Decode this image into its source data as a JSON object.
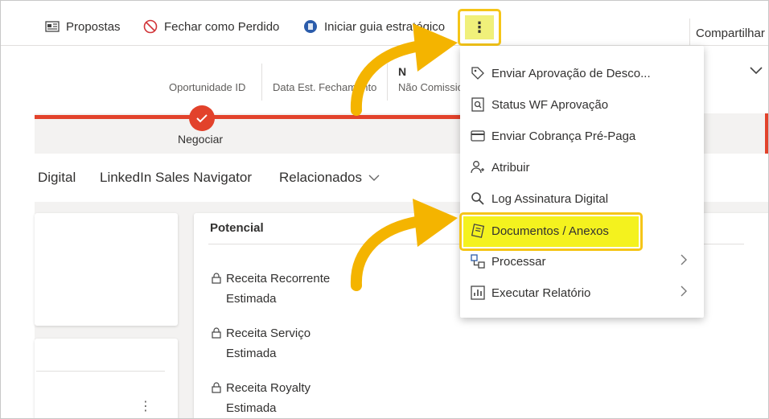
{
  "toolbar": {
    "proposals_label": "Propostas",
    "close_lost_label": "Fechar como Perdido",
    "start_guide_label": "Iniciar guia estratégico",
    "more_label": "⋮",
    "share_label": "Compartilhar"
  },
  "header": {
    "fields": [
      {
        "label": "Oportunidade ID"
      },
      {
        "label": "Data Est. Fechamento"
      },
      {
        "label": "Não Comissio",
        "value": "N"
      }
    ]
  },
  "process": {
    "active_stage": "Negociar"
  },
  "tabs": [
    {
      "label": "Digital"
    },
    {
      "label": "LinkedIn Sales Navigator"
    },
    {
      "label": "Relacionados"
    }
  ],
  "potential_card": {
    "title": "Potencial",
    "fields": [
      {
        "line1": "Receita Recorrente",
        "line2": "Estimada"
      },
      {
        "line1": "Receita Serviço",
        "line2": "Estimada"
      },
      {
        "line1": "Receita Royalty",
        "line2": "Estimada"
      }
    ]
  },
  "more_menu": {
    "items": [
      {
        "label": "Enviar Aprovação de Desco...",
        "icon": "tag-icon"
      },
      {
        "label": "Status WF Aprovação",
        "icon": "document-search-icon"
      },
      {
        "label": "Enviar Cobrança Pré-Paga",
        "icon": "card-icon"
      },
      {
        "label": "Atribuir",
        "icon": "person-add-icon"
      },
      {
        "label": "Log Assinatura Digital",
        "icon": "search-icon"
      },
      {
        "label": "Documentos / Anexos",
        "icon": "attachment-icon",
        "highlighted": true
      },
      {
        "label": "Processar",
        "icon": "flow-icon",
        "submenu": true
      },
      {
        "label": "Executar Relatório",
        "icon": "report-icon",
        "submenu": true
      }
    ]
  },
  "colors": {
    "accent": "#e2422b",
    "highlight": "#f4f21e",
    "highlight_border": "#f5c518",
    "arrow": "#fbbf00"
  }
}
